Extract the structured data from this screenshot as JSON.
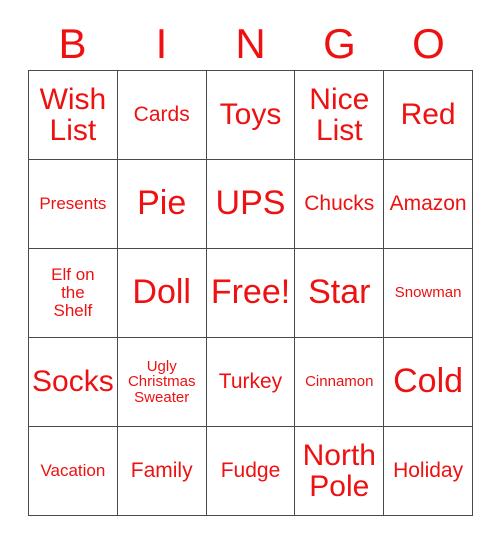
{
  "card": {
    "title_letters": [
      "B",
      "I",
      "N",
      "G",
      "O"
    ],
    "accent_color": "#ee1111",
    "border_color": "#4a4a4a",
    "background_color": "#ffffff",
    "rows": 5,
    "columns": 5,
    "cells": [
      [
        {
          "label": "Wish List",
          "size": "lg",
          "lines": [
            "Wish",
            "List"
          ]
        },
        {
          "label": "Cards",
          "size": "md",
          "lines": [
            "Cards"
          ]
        },
        {
          "label": "Toys",
          "size": "lg",
          "lines": [
            "Toys"
          ]
        },
        {
          "label": "Nice List",
          "size": "lg",
          "lines": [
            "Nice",
            "List"
          ]
        },
        {
          "label": "Red",
          "size": "lg",
          "lines": [
            "Red"
          ]
        }
      ],
      [
        {
          "label": "Presents",
          "size": "sm",
          "lines": [
            "Presents"
          ]
        },
        {
          "label": "Pie",
          "size": "xl",
          "lines": [
            "Pie"
          ]
        },
        {
          "label": "UPS",
          "size": "xl",
          "lines": [
            "UPS"
          ]
        },
        {
          "label": "Chucks",
          "size": "md",
          "lines": [
            "Chucks"
          ]
        },
        {
          "label": "Amazon",
          "size": "md",
          "lines": [
            "Amazon"
          ]
        }
      ],
      [
        {
          "label": "Elf on the Shelf",
          "size": "sm",
          "lines": [
            "Elf on",
            "the",
            "Shelf"
          ]
        },
        {
          "label": "Doll",
          "size": "xl",
          "lines": [
            "Doll"
          ]
        },
        {
          "label": "Free!",
          "size": "xl",
          "lines": [
            "Free!"
          ]
        },
        {
          "label": "Star",
          "size": "xl",
          "lines": [
            "Star"
          ]
        },
        {
          "label": "Snowman",
          "size": "xs",
          "lines": [
            "Snowman"
          ]
        }
      ],
      [
        {
          "label": "Socks",
          "size": "lg",
          "lines": [
            "Socks"
          ]
        },
        {
          "label": "Ugly Christmas Sweater",
          "size": "xs",
          "lines": [
            "Ugly",
            "Christmas",
            "Sweater"
          ]
        },
        {
          "label": "Turkey",
          "size": "md",
          "lines": [
            "Turkey"
          ]
        },
        {
          "label": "Cinnamon",
          "size": "xs",
          "lines": [
            "Cinnamon"
          ]
        },
        {
          "label": "Cold",
          "size": "xl",
          "lines": [
            "Cold"
          ]
        }
      ],
      [
        {
          "label": "Vacation",
          "size": "sm",
          "lines": [
            "Vacation"
          ]
        },
        {
          "label": "Family",
          "size": "md",
          "lines": [
            "Family"
          ]
        },
        {
          "label": "Fudge",
          "size": "md",
          "lines": [
            "Fudge"
          ]
        },
        {
          "label": "North Pole",
          "size": "lg",
          "lines": [
            "North",
            "Pole"
          ]
        },
        {
          "label": "Holiday",
          "size": "md",
          "lines": [
            "Holiday"
          ]
        }
      ]
    ],
    "free_space": {
      "row": 2,
      "column": 2,
      "label": "Free!"
    }
  }
}
